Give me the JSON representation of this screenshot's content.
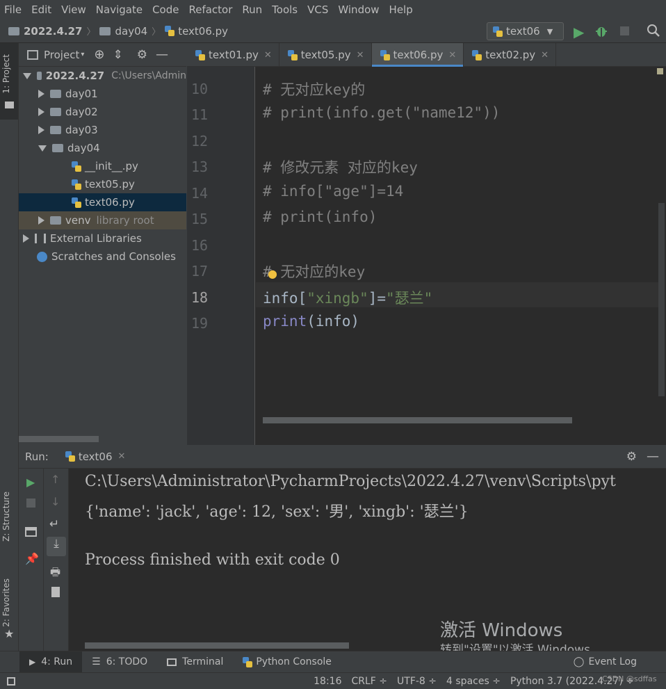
{
  "menu": [
    "File",
    "Edit",
    "View",
    "Navigate",
    "Code",
    "Refactor",
    "Run",
    "Tools",
    "VCS",
    "Window",
    "Help"
  ],
  "breadcrumb": {
    "project": "2022.4.27",
    "folder": "day04",
    "file": "text06.py"
  },
  "run_config": "text06",
  "left_strip": {
    "project_tab": "1: Project",
    "structure_tab": "Z: Structure",
    "favorites_tab": "2: Favorites"
  },
  "project_panel": {
    "title": "Project",
    "root_name": "2022.4.27",
    "root_path": "C:\\Users\\Admin",
    "items": {
      "day01": "day01",
      "day02": "day02",
      "day03": "day03",
      "day04": "day04",
      "init": "__init__.py",
      "text05": "text05.py",
      "text06": "text06.py",
      "venv": "venv",
      "venv_hint": "library root",
      "ext": "External Libraries",
      "scratch": "Scratches and Consoles"
    }
  },
  "tabs": [
    {
      "label": "text01.py"
    },
    {
      "label": "text05.py"
    },
    {
      "label": "text06.py",
      "active": true
    },
    {
      "label": "text02.py"
    }
  ],
  "editor": {
    "lines": [
      {
        "n": "10",
        "text": "# 无对应key的"
      },
      {
        "n": "11",
        "text": "# print(info.get(\"name12\"))"
      },
      {
        "n": "12",
        "text": ""
      },
      {
        "n": "13",
        "text": "# 修改元素 对应的key"
      },
      {
        "n": "14",
        "text": "# info[\"age\"]=14"
      },
      {
        "n": "15",
        "text": "# print(info)"
      },
      {
        "n": "16",
        "text": ""
      },
      {
        "n": "17",
        "text": "# 无对应的key"
      },
      {
        "n": "18",
        "text": "info[\"xingb\"]=\"瑟兰\""
      },
      {
        "n": "19",
        "text": "print(info)"
      }
    ]
  },
  "run": {
    "label": "Run:",
    "tab": "text06",
    "output": [
      "C:\\Users\\Administrator\\PycharmProjects\\2022.4.27\\venv\\Scripts\\pyt",
      "{'name': 'jack', 'age': 12, 'sex': '男', 'xingb': '瑟兰'}",
      "",
      "Process finished with exit code 0"
    ]
  },
  "bottom_tabs": {
    "run": "4: Run",
    "todo": "6: TODO",
    "terminal": "Terminal",
    "console": "Python Console",
    "eventlog": "Event Log"
  },
  "status": {
    "pos": "18:16",
    "eol": "CRLF ÷",
    "enc": "UTF-8 ÷",
    "indent": "4 spaces ÷",
    "interp": "Python 3.7 (2022.4.27) ÷"
  },
  "watermark": {
    "line1": "激活 Windows",
    "line2": "转到\"设置\"以激活 Windows。",
    "csdn": "CSDN @sdffas"
  }
}
